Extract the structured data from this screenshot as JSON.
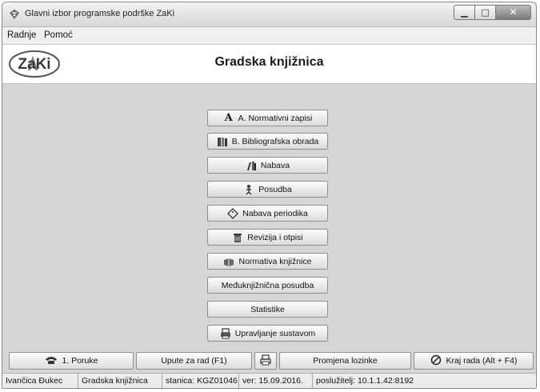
{
  "window": {
    "title": "Glavni izbor programske podrške ZaKi"
  },
  "menubar": {
    "items": [
      "Radnje",
      "Pomoć"
    ]
  },
  "header": {
    "logo_text": "ZaKi",
    "title": "Gradska knjižnica"
  },
  "main_menu": [
    {
      "label": "A. Normativni zapisi",
      "icon": "letter-a-icon"
    },
    {
      "label": "B. Bibliografska obrada",
      "icon": "books-icon"
    },
    {
      "label": "Nabava",
      "icon": "book-stack-icon"
    },
    {
      "label": "Posudba",
      "icon": "person-reading-icon"
    },
    {
      "label": "Nabava periodika",
      "icon": "tag-icon"
    },
    {
      "label": "Revizija i otpisi",
      "icon": "trash-icon"
    },
    {
      "label": "Normativa knjižnice",
      "icon": "open-book-icon"
    },
    {
      "label": "Međuknjižnična posudba",
      "icon": ""
    },
    {
      "label": "Statistike",
      "icon": ""
    },
    {
      "label": "Upravljanje sustavom",
      "icon": "printer-icon"
    }
  ],
  "bottombar": {
    "messages": "1. Poruke",
    "help": "Upute za rad (F1)",
    "change_password": "Promjena lozinke",
    "exit": "Kraj rada (Alt + F4)"
  },
  "statusbar": {
    "user": "Ivančica Đukec",
    "library": "Gradska knjižnica",
    "station": "stanica: KGZ01046",
    "version": "ver: 15.09.2016.",
    "server": "poslužitelj: 10.1.1.42:8192"
  }
}
